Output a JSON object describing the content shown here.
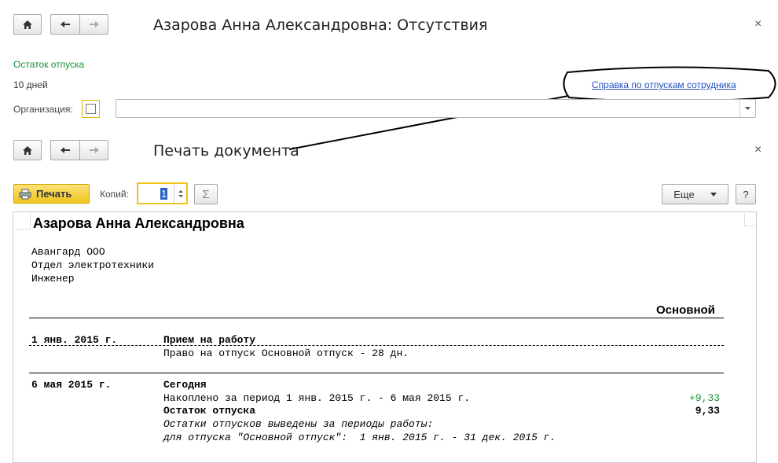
{
  "top_window": {
    "title": "Азарова Анна Александровна: Отсутствия",
    "vacation_balance_link": "Остаток отпуска",
    "vacation_days": "10 дней",
    "vacation_report_link": "Справка по отпускам сотрудника",
    "organization_label": "Организация:",
    "organization_value": ""
  },
  "print_window": {
    "title": "Печать документа",
    "print_button": "Печать",
    "copies_label": "Копий:",
    "copies_value": "1",
    "more_button": "Еще",
    "help_button": "?",
    "sum_button": "Σ"
  },
  "document": {
    "employee_name": "Азарова Анна Александровна",
    "company": "Авангард ООО",
    "department": "Отдел электротехники",
    "position": "Инженер",
    "column_header": "Основной",
    "entries": [
      {
        "date": "1 янв. 2015 г.",
        "event": "Прием на работу",
        "detail": "Право на отпуск Основной отпуск - 28 дн."
      },
      {
        "date": "6 мая 2015 г.",
        "event": "Сегодня",
        "accrued_text": "Накоплено за период 1 янв. 2015 г. - 6 мая 2015 г.",
        "accrued_value": "+9,33",
        "balance_label": "Остаток отпуска",
        "balance_value": "9,33",
        "note_line1": "Остатки отпусков выведены за периоды работы:",
        "note_line2": "для отпуска \"Основной отпуск\":  1 янв. 2015 г. - 31 дек. 2015 г."
      }
    ]
  },
  "colors": {
    "link_green": "#1a8f3a",
    "link_blue": "#1f4fbf",
    "print_button_yellow": "#f5d13a",
    "accrued_green": "#1a8f3a"
  }
}
